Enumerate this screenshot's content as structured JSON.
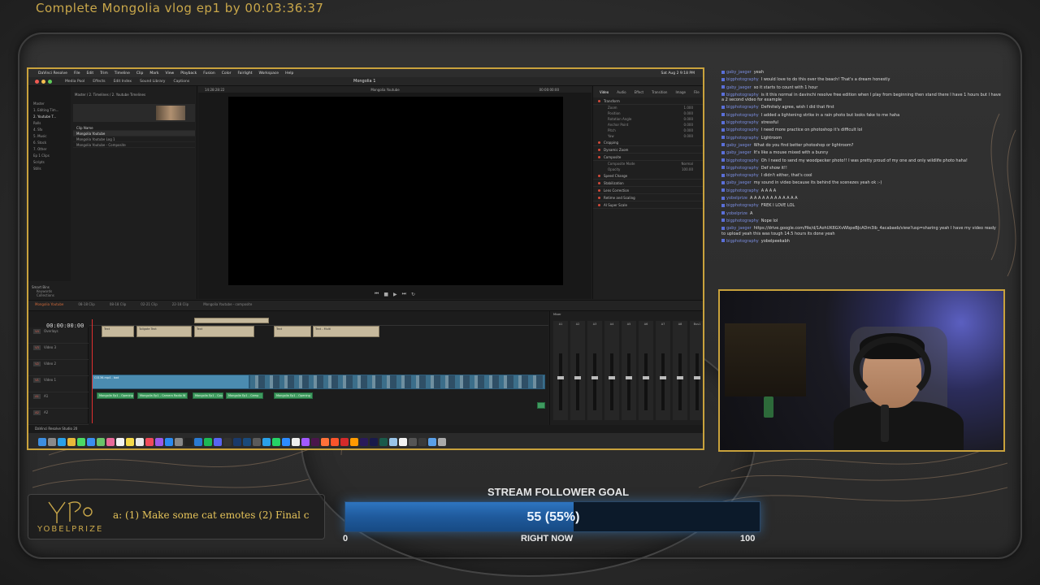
{
  "overlay": {
    "title": "Complete Mongolia vlog ep1 by 00:03:36:37",
    "logo_text": "YOBELPRIZE",
    "ticker": "a: (1) Make some cat emotes (2) Final c"
  },
  "goal": {
    "title": "STREAM FOLLOWER GOAL",
    "value_text": "55 (55%)",
    "progress_percent": 55,
    "min_label": "0",
    "now_label": "RIGHT NOW",
    "max_label": "100",
    "fill_color": "#1f5a9c"
  },
  "resolve": {
    "menubar": [
      "DaVinci Resolve",
      "File",
      "Edit",
      "Trim",
      "Timeline",
      "Clip",
      "Mark",
      "View",
      "Playback",
      "Fusion",
      "Color",
      "Fairlight",
      "Workspace",
      "Help"
    ],
    "clock": "Sat Aug 2  9:18 PM",
    "toolbar": [
      "Media Pool",
      "Effects",
      "Edit Index",
      "Sound Library",
      "Captions"
    ],
    "project_title": "Mongolia 1",
    "viewer_timecode_left": "14:28:28:22",
    "viewer_label": "Mongolia Youtube",
    "viewer_timecode_right": "00:00:00:00",
    "inspector_tabs": [
      "Video",
      "Audio",
      "Effect",
      "Transition",
      "Image",
      "File"
    ],
    "inspector_sections": [
      "Transform",
      "Cropping",
      "Dynamic Zoom",
      "Composite",
      "Speed Change",
      "Stabilization",
      "Lens Correction",
      "Retime and Scaling",
      "AI Super Scale"
    ],
    "inspector_rows": [
      {
        "label": "Zoom",
        "value": "1.000"
      },
      {
        "label": "Position",
        "value": "0.000"
      },
      {
        "label": "Rotation Angle",
        "value": "0.000"
      },
      {
        "label": "Anchor Point",
        "value": "0.000"
      },
      {
        "label": "Pitch",
        "value": "0.000"
      },
      {
        "label": "Yaw",
        "value": "0.000"
      }
    ],
    "composite_mode": "Normal",
    "opacity": "100.00",
    "bins": [
      "Master",
      "1. Editing Tim...",
      "2. Youtube T...",
      "Rolls",
      "4. Sfx",
      "5. Music",
      "6. Stock",
      "7. Other",
      "Ep 1 Clips",
      "Scripts",
      "Stills"
    ],
    "clip_list_header": "Clip Name",
    "clips": [
      "Mongolia Youtube",
      "Mongolia Youtube Log 1",
      "Mongolia Youtube - Composite"
    ],
    "breadcrumb": "Master / 2. Timelines / 2. Youtube Timelines",
    "smart_bins": [
      "Smart Bins",
      "Keywords",
      "Collections"
    ],
    "timeline_tabs": [
      "Mongolia Youtube",
      "08-18 Clip",
      "08-18 Clip",
      "02-21 Clip",
      "22-18 Clip",
      "Mongolia Youtube - composite"
    ],
    "timecode": "00:00:00:00",
    "tracks": [
      {
        "id": "V4",
        "name": "Overlays"
      },
      {
        "id": "V3",
        "name": "Video 3"
      },
      {
        "id": "V2",
        "name": "Video 2"
      },
      {
        "id": "V1",
        "name": "Video 1"
      },
      {
        "id": "A1",
        "name": "A1"
      },
      {
        "id": "A2",
        "name": "A2"
      }
    ],
    "tan_clips": [
      "Text",
      "Tollgate Text",
      "Text",
      "Text",
      "Text - Multi"
    ],
    "film_clip_label": "C0136.mp4 - bad",
    "audio_clips": [
      "Mongolia Ep1 - Opening",
      "Mongolia Ep1 - Camera Radio W",
      "Mongolia Ep1 - Cou",
      "Mongolia Ep1 - Camp",
      "Mongolia Ep1 - Opening"
    ],
    "mixer_title": "Mixer",
    "mixer_channels": [
      "A1",
      "A2",
      "A3",
      "A4",
      "A5",
      "A6",
      "A7",
      "A8",
      "Bus1"
    ],
    "status": "DaVinci Resolve Studio 20"
  },
  "chat": [
    {
      "user": "gaby_jaeger",
      "text": "yeah"
    },
    {
      "user": "bigphotography",
      "text": "I would love to do this over the beach! That's a dream honestly"
    },
    {
      "user": "gaby_jaeger",
      "text": "so it starts to count with 1 hour"
    },
    {
      "user": "bigphotography",
      "text": "is it this normal in davinchi resolve free edition when I play from beginning then stand there I have 1 hours but I have a 2 second video for example"
    },
    {
      "user": "bigphotography",
      "text": "Definitely agree, wish I did that first"
    },
    {
      "user": "bigphotography",
      "text": "I added a lightening strike in a rain photo but looks fake to me haha"
    },
    {
      "user": "bigphotography",
      "text": "stressful"
    },
    {
      "user": "bigphotography",
      "text": "I need more practice on photoshop it's difficult lol"
    },
    {
      "user": "bigphotography",
      "text": "Lightroom"
    },
    {
      "user": "gaby_jaeger",
      "text": "What do you find better photoshop or lightroom?"
    },
    {
      "user": "gaby_jaeger",
      "text": "It's like a mouse mixed with a bunny"
    },
    {
      "user": "bigphotography",
      "text": "Oh I need to send my woodpecker photo!! I was pretty proud of my one and only wildlife photo haha!"
    },
    {
      "user": "bigphotography",
      "text": "Def show it!!"
    },
    {
      "user": "bigphotography",
      "text": "I didn't either, that's cool"
    },
    {
      "user": "gaby_jaeger",
      "text": "my sound in video because its behind the scenezes yeah ok :-)"
    },
    {
      "user": "bigphotography",
      "text": "A A A A"
    },
    {
      "user": "yobelprize",
      "text": "A A A A A A A A A A A A"
    },
    {
      "user": "bigphotography",
      "text": "FREK I LOVE LOL"
    },
    {
      "user": "yobelprize",
      "text": "A"
    },
    {
      "user": "bigphotography",
      "text": "Nope lol"
    },
    {
      "user": "gaby_jaeger",
      "text": "https://drive.google.com/file/d/1AohUK6GXvWbpeBJcADm3ib_4acabaeb/view?usp=sharing yeah I have my video ready to upload yeah this was tough 14.5 hours its done yeah"
    },
    {
      "user": "bigphotography",
      "text": "yobelpeekabh"
    }
  ]
}
